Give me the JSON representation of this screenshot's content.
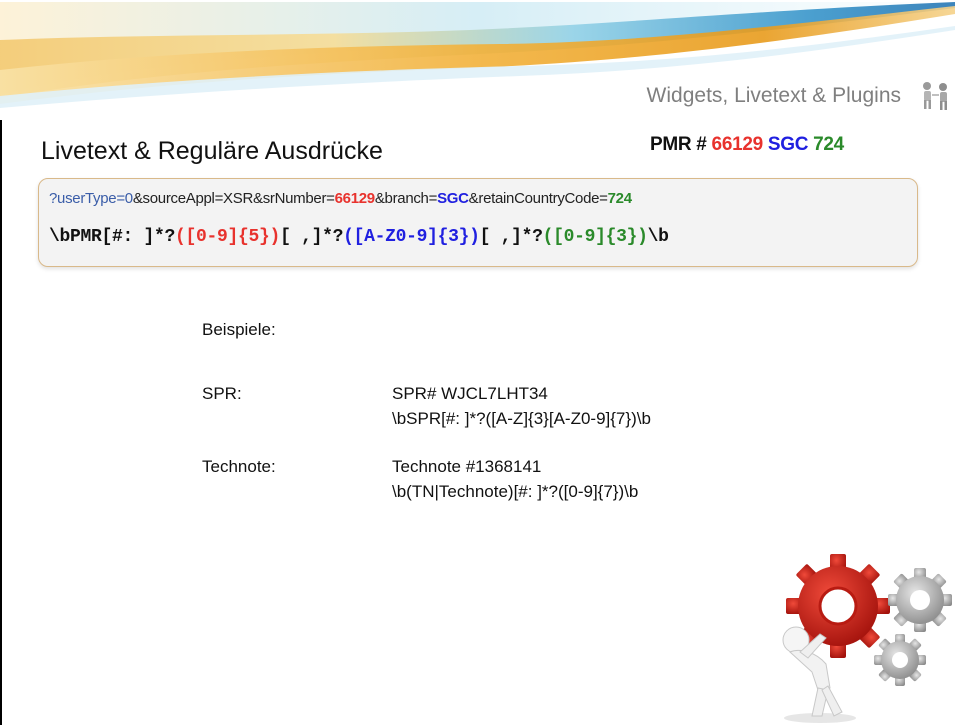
{
  "header": {
    "section_title": "Widgets, Livetext & Plugins",
    "icon": "people-icon"
  },
  "slide_title": "Livetext & Reguläre Ausdrücke",
  "pmr": {
    "prefix": "PMR # ",
    "number": "66129",
    "branch": "SGC",
    "country": "724",
    "colors": {
      "number": "#e8322d",
      "branch": "#2020e0",
      "country": "#2a8a2a"
    }
  },
  "codebox": {
    "url_parts": {
      "part1": "?userType=0",
      "part2": "&sourceAppl=XSR&srNumber=",
      "part3": "66129",
      "part4": "&branch=",
      "part5": "SGC",
      "part6": "&retainCountryCode=",
      "part7": "724"
    },
    "regex_parts": {
      "part1": "\\bPMR[#: ]*?",
      "part2": "([0-9]{5})",
      "part3": "[ ,]*?",
      "part4": "([A-Z0-9]{3})",
      "part5": "[ ,]*?",
      "part6": "([0-9]{3})",
      "part7": "\\b"
    }
  },
  "examples": {
    "heading": "Beispiele:",
    "items": [
      {
        "label": "SPR:",
        "example": "SPR# WJCL7LHT34",
        "regex": "\\bSPR[#: ]*?([A-Z]{3}[A-Z0-9]{7})\\b"
      },
      {
        "label": "Technote:",
        "example": "Technote #1368141",
        "regex": "\\b(TN|Technote)[#: ]*?([0-9]{7})\\b"
      }
    ]
  },
  "illustration": "gears-person-illustration"
}
